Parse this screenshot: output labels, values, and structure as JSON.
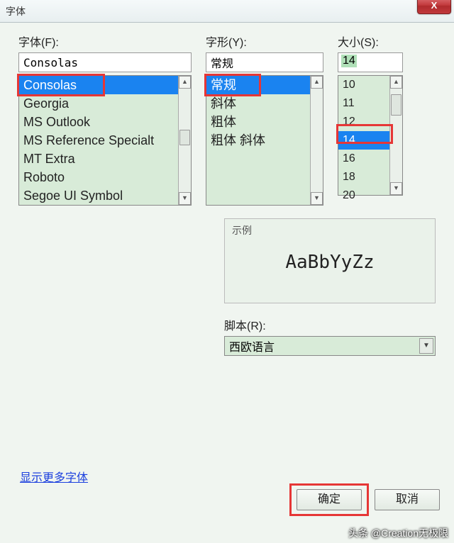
{
  "title": "字体",
  "labels": {
    "font": "字体(F):",
    "style": "字形(Y):",
    "size": "大小(S):",
    "preview": "示例",
    "script": "脚本(R):",
    "moreFonts": "显示更多字体",
    "ok": "确定",
    "cancel": "取消"
  },
  "inputs": {
    "font": "Consolas",
    "style": "常规",
    "size": "14"
  },
  "fontList": {
    "selectedIndex": 0,
    "items": [
      "Consolas",
      "Georgia",
      "MS Outlook",
      "MS Reference Specialt",
      "MT Extra",
      "Roboto",
      "Segoe UI Symbol"
    ]
  },
  "styleList": {
    "selectedIndex": 0,
    "items": [
      "常规",
      "斜体",
      "粗体",
      "粗体 斜体"
    ]
  },
  "sizeList": {
    "selectedIndex": 3,
    "items": [
      "10",
      "11",
      "12",
      "14",
      "16",
      "18",
      "20"
    ]
  },
  "previewText": "AaBbYyZz",
  "script": {
    "value": "西欧语言"
  },
  "watermark": "头条 @Creation无极限"
}
